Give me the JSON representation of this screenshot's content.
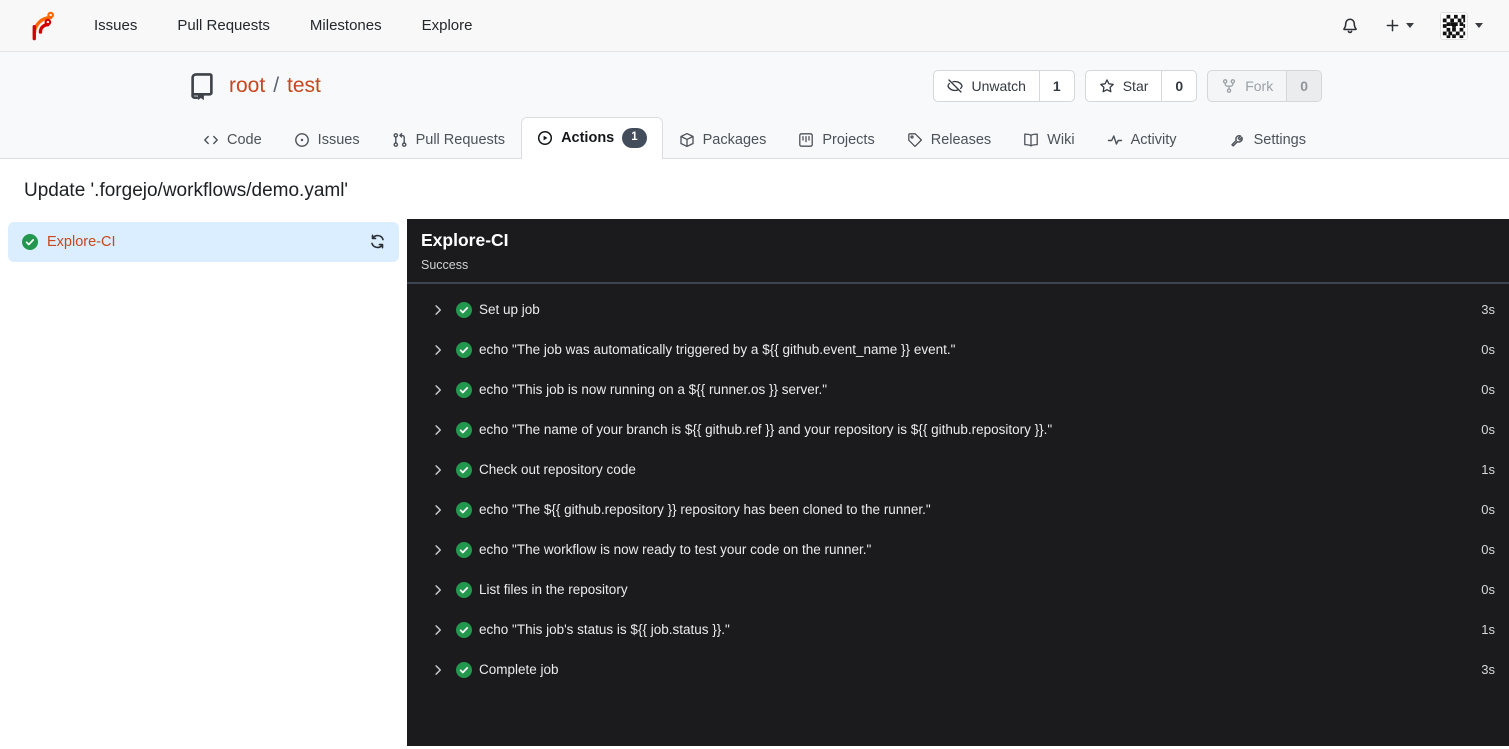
{
  "navbar": {
    "items": [
      "Issues",
      "Pull Requests",
      "Milestones",
      "Explore"
    ]
  },
  "repo": {
    "owner": "root",
    "separator": "/",
    "name": "test",
    "watch": {
      "label": "Unwatch",
      "count": "1"
    },
    "star": {
      "label": "Star",
      "count": "0"
    },
    "fork": {
      "label": "Fork",
      "count": "0"
    }
  },
  "tabs": [
    {
      "label": "Code"
    },
    {
      "label": "Issues"
    },
    {
      "label": "Pull Requests"
    },
    {
      "label": "Actions",
      "badge": "1",
      "active": true
    },
    {
      "label": "Packages"
    },
    {
      "label": "Projects"
    },
    {
      "label": "Releases"
    },
    {
      "label": "Wiki"
    },
    {
      "label": "Activity"
    },
    {
      "label": "Settings"
    }
  ],
  "page": {
    "title": "Update '.forgejo/workflows/demo.yaml'"
  },
  "sidebar": {
    "job_label": "Explore-CI"
  },
  "panel": {
    "title": "Explore-CI",
    "status": "Success",
    "steps": [
      {
        "label": "Set up job",
        "duration": "3s"
      },
      {
        "label": "echo \"The job was automatically triggered by a ${{ github.event_name }} event.\"",
        "duration": "0s"
      },
      {
        "label": "echo \"This job is now running on a ${{ runner.os }} server.\"",
        "duration": "0s"
      },
      {
        "label": "echo \"The name of your branch is ${{ github.ref }} and your repository is ${{ github.repository }}.\"",
        "duration": "0s"
      },
      {
        "label": "Check out repository code",
        "duration": "1s"
      },
      {
        "label": "echo \"The ${{ github.repository }} repository has been cloned to the runner.\"",
        "duration": "0s"
      },
      {
        "label": "echo \"The workflow is now ready to test your code on the runner.\"",
        "duration": "0s"
      },
      {
        "label": "List files in the repository",
        "duration": "0s"
      },
      {
        "label": "echo \"This job's status is ${{ job.status }}.\"",
        "duration": "1s"
      },
      {
        "label": "Complete job",
        "duration": "3s"
      }
    ]
  },
  "colors": {
    "accent_orange": "#c8471d",
    "logo_orange": "#ff6600",
    "logo_red": "#d40000",
    "success_green": "#23974e",
    "selected_row_blue": "#dbeeff",
    "panel_dark": "#1b1b1d",
    "badge_slate": "#424c5b"
  }
}
